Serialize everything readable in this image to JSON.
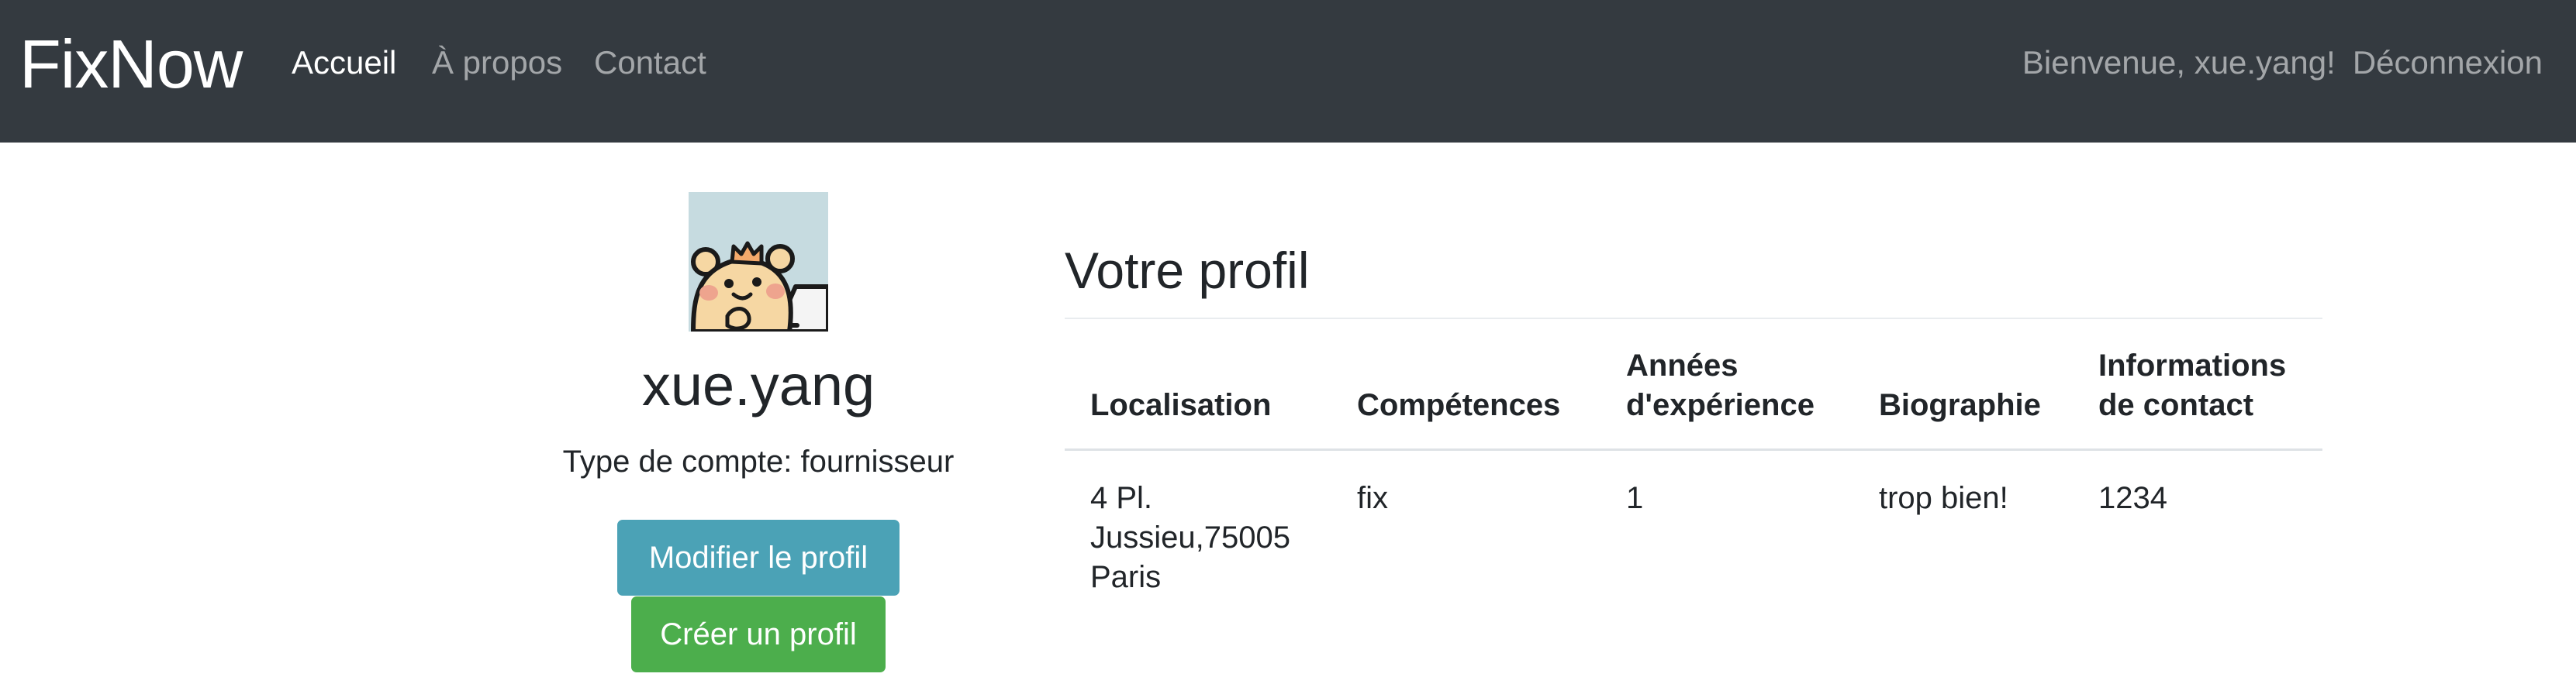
{
  "navbar": {
    "brand": "FixNow",
    "links": [
      "Accueil",
      "À propos",
      "Contact"
    ],
    "welcome": "Bienvenue, xue.yang!",
    "logout": "Déconnexion"
  },
  "profile_card": {
    "username": "xue.yang",
    "account_type": "Type de compte: fournisseur",
    "edit_button": "Modifier le profil",
    "create_button": "Créer un profil"
  },
  "profile_table": {
    "title": "Votre profil",
    "headers": {
      "location": "Localisation",
      "skills": "Compétences",
      "experience_line1": "Années",
      "experience_line2": "d'expérience",
      "biography": "Biographie",
      "contact_line1": "Informations",
      "contact_line2": "de contact"
    },
    "row": {
      "location_line1": "4 Pl.",
      "location_line2": "Jussieu,75005",
      "location_line3": "Paris",
      "skills": "fix",
      "experience": "1",
      "biography": "trop bien!",
      "contact": "1234"
    }
  },
  "colors": {
    "navbar_bg": "#343a40",
    "info_button": "#4ba2b6",
    "success_button": "#4cae4c"
  }
}
